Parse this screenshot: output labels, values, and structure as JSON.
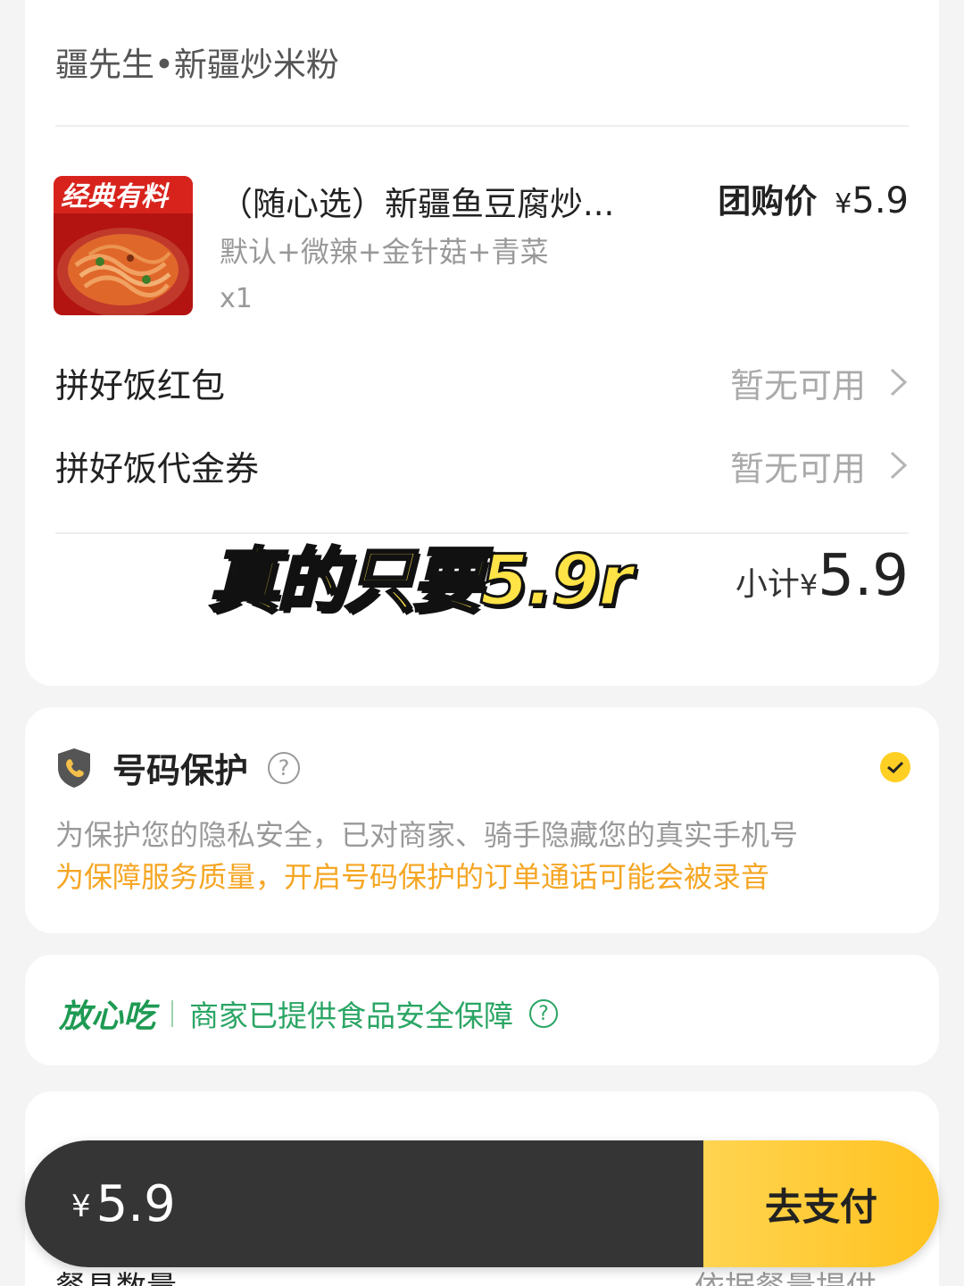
{
  "order": {
    "shop_name": "疆先生•新疆炒米粉",
    "item": {
      "thumb_banner": "经典有料",
      "name": "（随心选）新疆鱼豆腐炒...",
      "spec": "默认+微辣+金针菇+青菜",
      "qty": "x1",
      "price_label": "团购价",
      "currency": "¥",
      "price": "5.9"
    },
    "rows": [
      {
        "title": "拼好饭红包",
        "value": "暂无可用"
      },
      {
        "title": "拼好饭代金券",
        "value": "暂无可用"
      }
    ],
    "overlay_text": "真的只要5.9r",
    "subtotal": {
      "label": "小计",
      "currency": "¥",
      "value": "5.9"
    }
  },
  "protect": {
    "title": "号码保护",
    "line1": "为保护您的隐私安全，已对商家、骑手隐藏您的真实手机号",
    "line2": "为保障服务质量，开启号码保护的订单通话可能会被录音",
    "checked": true
  },
  "safe": {
    "brand": "放心吃",
    "text": "商家已提供食品安全保障"
  },
  "bottom": {
    "left_label": "餐具数量",
    "right_label": "依据餐量提供"
  },
  "paybar": {
    "currency": "¥",
    "total": "5.9",
    "button": "去支付"
  },
  "colors": {
    "accent": "#ffc21f",
    "warning": "#f5a623",
    "safe_green": "#2aa564",
    "paybar_dark": "#353535"
  }
}
